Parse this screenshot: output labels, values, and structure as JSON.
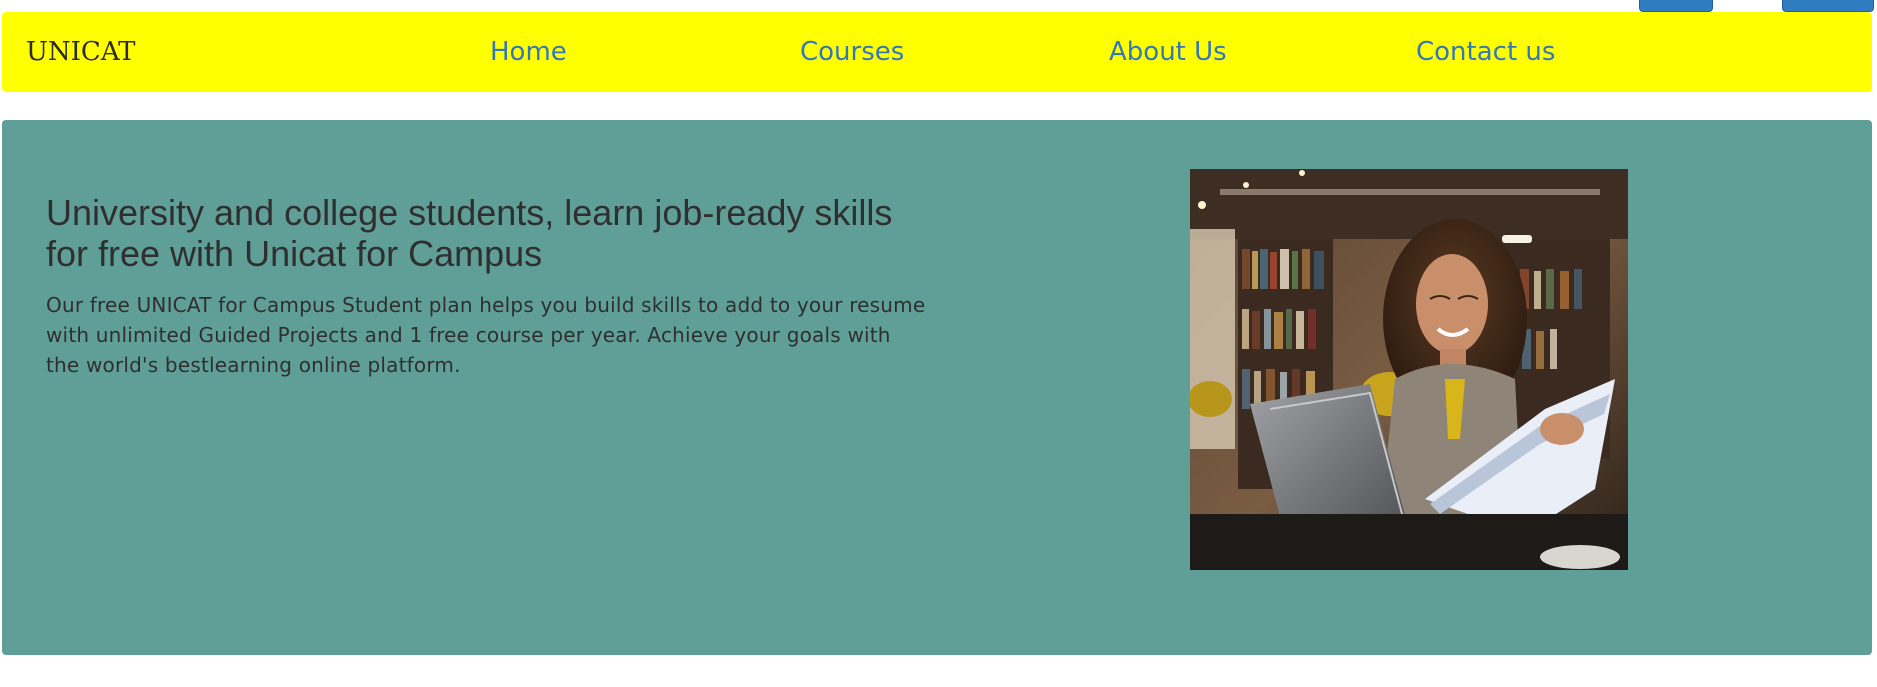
{
  "navbar": {
    "brand": "UNICAT",
    "links": [
      {
        "label": "Home"
      },
      {
        "label": "Courses"
      },
      {
        "label": "About Us"
      },
      {
        "label": "Contact us"
      }
    ]
  },
  "hero": {
    "title": "University and college students, learn job-ready skills for free with Unicat for Campus",
    "text": "Our free UNICAT for Campus Student plan helps you build skills to add to your resume with unlimited Guided Projects and 1 free course per year. Achieve your goals with the world's bestlearning online platform.",
    "image_subject": "student-with-laptop-photo"
  },
  "colors": {
    "navbar_bg": "#ffff00",
    "nav_link": "#3478b9",
    "hero_bg": "#5f9f97",
    "text": "#2f2f2f",
    "top_buttons": "#2f7cc0"
  }
}
